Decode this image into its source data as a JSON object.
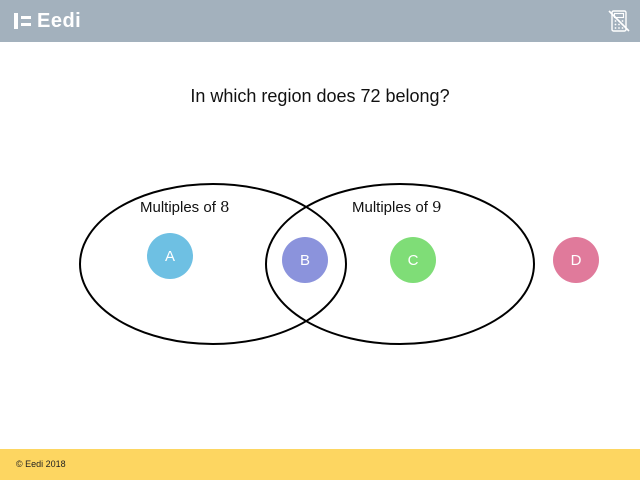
{
  "header": {
    "brand": "Eedi",
    "calculator_icon": "no-calculator-icon",
    "background": "#a3b1bd"
  },
  "question": "In which region does 72 belong?",
  "venn": {
    "set_left": {
      "label": "Multiples of",
      "number": "8"
    },
    "set_right": {
      "label": "Multiples of",
      "number": "9"
    }
  },
  "options": [
    {
      "label": "A",
      "color": "#6ec0e3"
    },
    {
      "label": "B",
      "color": "#8b93dc"
    },
    {
      "label": "C",
      "color": "#7fdd77"
    },
    {
      "label": "D",
      "color": "#e07a9b"
    }
  ],
  "footer": {
    "copyright": "© Eedi 2018",
    "background": "#fdd661"
  }
}
